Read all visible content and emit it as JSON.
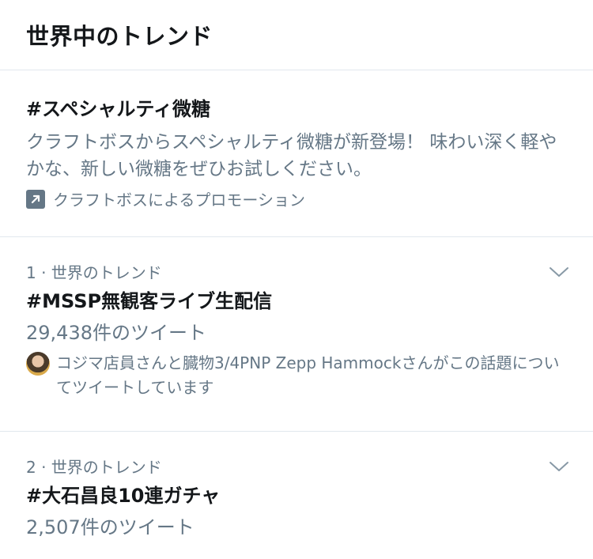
{
  "header": {
    "title": "世界中のトレンド"
  },
  "promo": {
    "tag": "#スペシャルティ微糖",
    "description": "クラフトボスからスペシャルティ微糖が新登場！ 味わい深く軽やかな、新しい微糖をぜひお試しください。",
    "promoted_by": "クラフトボスによるプロモーション",
    "icon": "promoted-arrow-icon"
  },
  "trends": [
    {
      "meta": "1 · 世界のトレンド",
      "name": "#MSSP無観客ライブ生配信",
      "count": "29,438件のツイート",
      "context": "コジマ店員さんと臓物3/4PNP Zepp Hammockさんがこの話題についてツイートしています"
    },
    {
      "meta": "2 · 世界のトレンド",
      "name": "#大石昌良10連ガチャ",
      "count": "2,507件のツイート"
    }
  ],
  "colors": {
    "text": "#14171a",
    "secondary": "#657786",
    "divider": "#e1e8ed"
  }
}
